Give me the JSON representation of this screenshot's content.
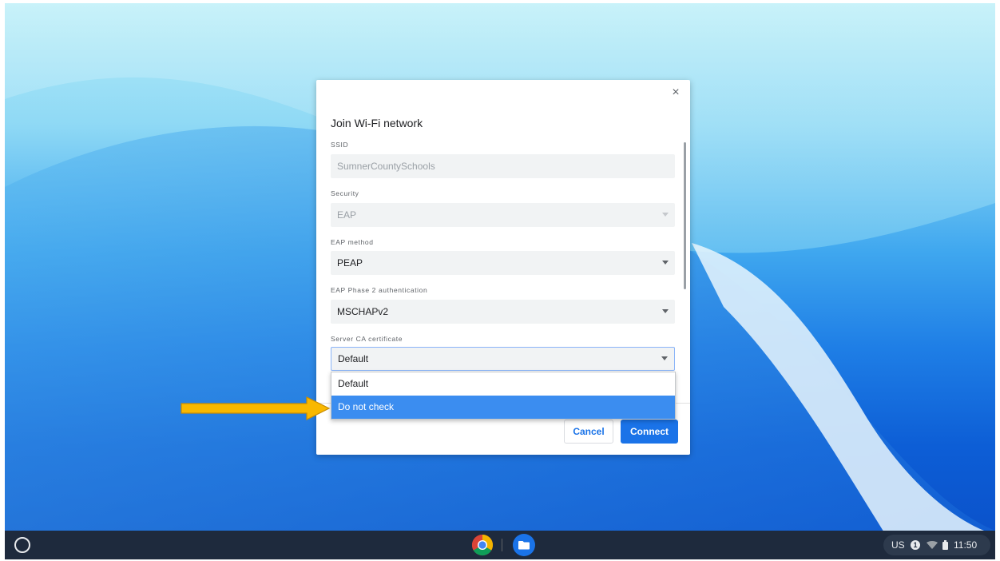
{
  "dialog": {
    "close_glyph": "×",
    "title": "Join Wi-Fi network",
    "fields": [
      {
        "label": "SSID",
        "value": "SumnerCountySchools",
        "state": "disabled-input"
      },
      {
        "label": "Security",
        "value": "EAP",
        "state": "disabled-select"
      },
      {
        "label": "EAP method",
        "value": "PEAP",
        "state": "select"
      },
      {
        "label": "EAP Phase 2 authentication",
        "value": "MSCHAPv2",
        "state": "select"
      },
      {
        "label": "Server CA certificate",
        "value": "Default",
        "state": "select-open"
      }
    ],
    "dropdown_options": [
      "Default",
      "Do not check"
    ],
    "highlighted_option": "Do not check",
    "cancel_label": "Cancel",
    "connect_label": "Connect"
  },
  "shelf": {
    "apps": [
      "chrome-icon",
      "files-icon"
    ],
    "status": {
      "keyboard": "US",
      "notification_count": "1",
      "time": "11:50"
    }
  },
  "colors": {
    "accent": "#1a73e8",
    "highlight": "#3b8df0",
    "arrow": "#f9b800",
    "shelf": "#1e2a3d"
  }
}
